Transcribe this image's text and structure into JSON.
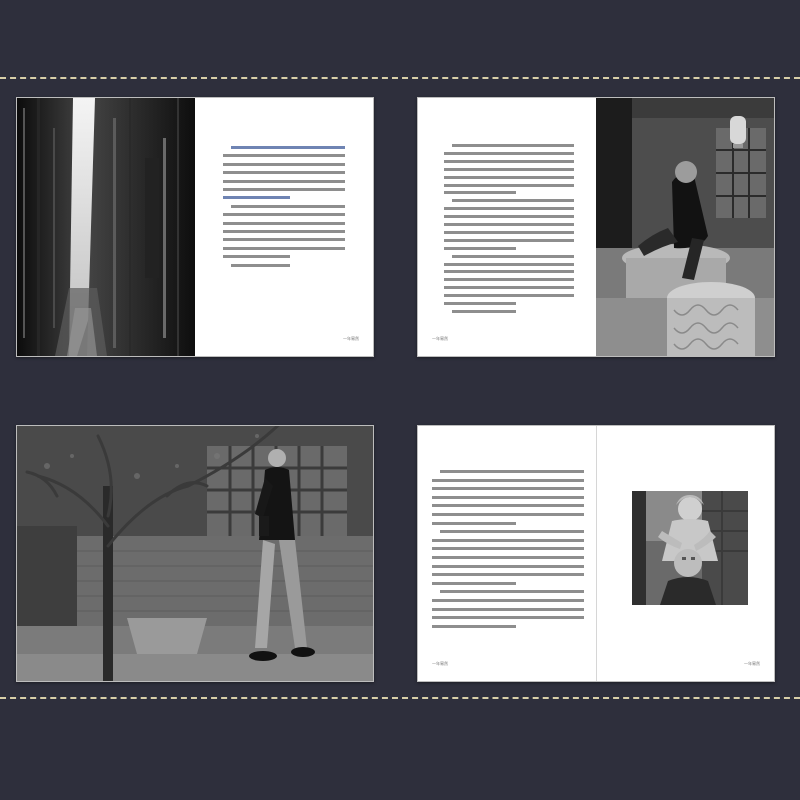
{
  "colors": {
    "background": "#2e2f3c",
    "stitch": "#d8cfa8",
    "page": "#ffffff",
    "text_gray": "#8e8e8e",
    "text_blue": "#6f84b3"
  },
  "spreads": [
    {
      "id": "spread-1",
      "layout": "photo-left-text-right",
      "photo": {
        "subject": "narrow alley between tall dark walls"
      },
      "text_lines": 15,
      "highlight_lines": [
        0,
        6
      ],
      "footer_left": "",
      "footer_right": "一年蓦然"
    },
    {
      "id": "spread-2",
      "layout": "text-left-photo-right",
      "photo": {
        "subject": "man seated on carved stone in courtyard with lantern"
      },
      "text_lines": 22,
      "highlight_lines": [],
      "footer_left": "一年蓦然",
      "footer_right": ""
    },
    {
      "id": "spread-3",
      "layout": "full-photo",
      "photo": {
        "subject": "man in leather jacket walking past tree and old building"
      },
      "text_lines": 0,
      "highlight_lines": [],
      "footer_left": "",
      "footer_right": ""
    },
    {
      "id": "spread-4",
      "layout": "text-left-photo-inset-right",
      "photo": {
        "subject": "woman shaving a man's head"
      },
      "text_lines": 19,
      "highlight_lines": [],
      "footer_left": "一年蓦然",
      "footer_right": "一年蓦然"
    }
  ]
}
